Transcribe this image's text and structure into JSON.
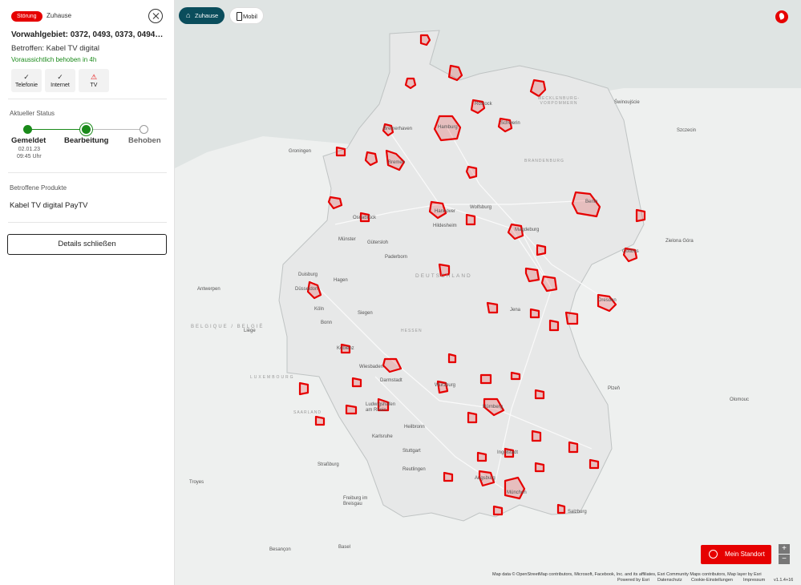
{
  "panel": {
    "badge": "Störung",
    "category": "Zuhause",
    "area_title": "Vorwahlgebiet: 0372, 0493, 0373, 0494, 04...",
    "affected": "Betroffen: Kabel TV digital",
    "eta": "Voraussichtlich behoben in 4h",
    "services": [
      {
        "label": "Telefonie",
        "state": "ok",
        "icon": "check-icon"
      },
      {
        "label": "Internet",
        "state": "ok",
        "icon": "check-icon"
      },
      {
        "label": "TV",
        "state": "warning",
        "icon": "warning-icon"
      }
    ],
    "status_heading": "Aktueller Status",
    "steps": [
      {
        "label": "Gemeldet",
        "state": "done"
      },
      {
        "label": "Bearbeitung",
        "state": "active"
      },
      {
        "label": "Behoben",
        "state": "todo"
      }
    ],
    "reported_date": "02.01.23",
    "reported_time": "09:45 Uhr",
    "products_heading": "Betroffene Produkte",
    "product": "Kabel TV digital PayTV",
    "details_button": "Details schließen"
  },
  "map": {
    "tabs": [
      {
        "label": "Zuhause",
        "active": true,
        "icon": "home-icon"
      },
      {
        "label": "Mobil",
        "active": false,
        "icon": "phone-icon"
      }
    ],
    "my_location": "Mein Standort",
    "zoom_in": "+",
    "zoom_out": "−",
    "attribution": "Map data © OpenStreetMap contributors, Microsoft, Facebook, Inc. and its affiliates, Esri Community Maps contributors, Map layer by Esri",
    "footer_links": [
      "Powered by Esri",
      "Datenschutz",
      "Cookie-Einstellungen",
      "Impressum",
      "v1.1.4+16"
    ],
    "cities": [
      "Hamburg",
      "Bremen",
      "Berlin",
      "Hannover",
      "Wolfsburg",
      "Magdeburg",
      "Hildesheim",
      "Osnabrück",
      "Münster",
      "Gütersloh",
      "Paderborn",
      "Duisburg",
      "Hagen",
      "Düsseldorf",
      "Köln",
      "Siegen",
      "Bonn",
      "Koblenz",
      "Wiesbaden",
      "Darmstadt",
      "Würzburg",
      "Nürnberg",
      "Ludwigshafen am Rhein",
      "Heilbronn",
      "Karlsruhe",
      "Stuttgart",
      "Reutlingen",
      "Ingolstadt",
      "Augsburg",
      "München",
      "Salzburg",
      "Straßburg",
      "Freiburg im Breisgau",
      "Jena",
      "Dresden",
      "Cottbus",
      "Schwerin",
      "Rostock",
      "Bremerhaven",
      "Groningen",
      "Antwerpen",
      "Liège",
      "Troyes",
      "Besançon",
      "Basel",
      "Plzeň",
      "Zielona Góra",
      "Olomouc",
      "Szczecin",
      "Świnoujście"
    ],
    "countries": [
      "DEUTSCHLAND",
      "BELGIQUE / BELGIË",
      "LUXEMBOURG",
      "SAARLAND",
      "HESSEN",
      "BRANDENBURG",
      "MECKLENBURG-VORPOMMERN"
    ]
  }
}
